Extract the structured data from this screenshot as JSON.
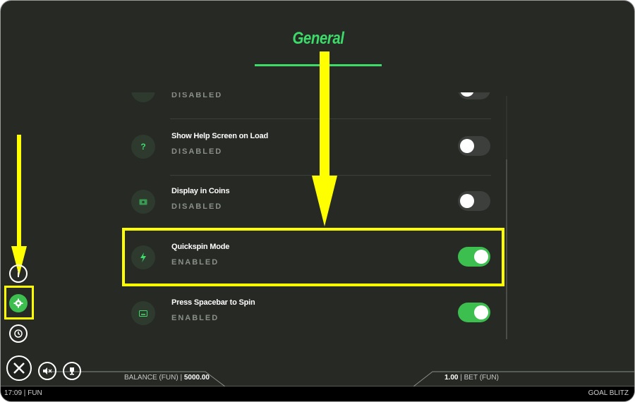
{
  "page": {
    "title": "General"
  },
  "settings": [
    {
      "label": "",
      "status": "DISABLED",
      "enabled": false,
      "icon": "setting-icon"
    },
    {
      "label": "Show Help Screen on Load",
      "status": "DISABLED",
      "enabled": false,
      "icon": "question-icon",
      "glyph": "?"
    },
    {
      "label": "Display in Coins",
      "status": "DISABLED",
      "enabled": false,
      "icon": "coins-icon"
    },
    {
      "label": "Quickspin Mode",
      "status": "ENABLED",
      "enabled": true,
      "icon": "lightning-icon"
    },
    {
      "label": "Press Spacebar to Spin",
      "status": "ENABLED",
      "enabled": true,
      "icon": "keyboard-icon"
    }
  ],
  "footer": {
    "balance_label": "BALANCE (FUN)",
    "balance_value": "5000.00",
    "bet_value": "1.00",
    "bet_label": "BET",
    "bet_currency": "(FUN)",
    "time": "17:09",
    "mode": "FUN",
    "game_name": "GOAL BLITZ"
  },
  "colors": {
    "accent": "#3ddc6a",
    "annotation": "#ffff00",
    "background": "#262924",
    "toggle_on": "#3cbf4f"
  }
}
